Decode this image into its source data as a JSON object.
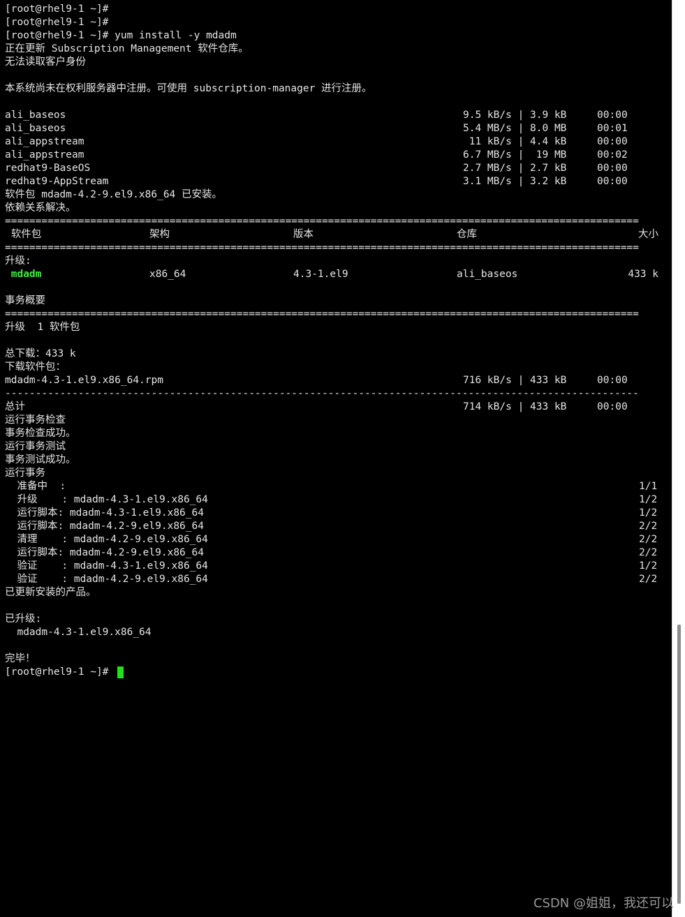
{
  "terminal": {
    "lines": [
      {
        "a": "[root@rhel9-1 ~]#"
      },
      {
        "a": "[root@rhel9-1 ~]#"
      },
      {
        "a": "[root@rhel9-1 ~]# yum install -y mdadm"
      },
      {
        "a": "正在更新 Subscription Management 软件仓库。"
      },
      {
        "a": "无法读取客户身份"
      },
      {
        "a": ""
      },
      {
        "a": "本系统尚未在权利服务器中注册。可使用 subscription-manager 进行注册。"
      },
      {
        "a": ""
      },
      {
        "a": "ali_baseos",
        "b": "9.5 kB/s | 3.9 kB     00:00"
      },
      {
        "a": "ali_baseos",
        "b": "5.4 MB/s | 8.0 MB     00:01"
      },
      {
        "a": "ali_appstream",
        "b": " 11 kB/s | 4.4 kB     00:00"
      },
      {
        "a": "ali_appstream",
        "b": "6.7 MB/s |  19 MB     00:02"
      },
      {
        "a": "redhat9-BaseOS",
        "b": "2.7 MB/s | 2.7 kB     00:00"
      },
      {
        "a": "redhat9-AppStream",
        "b": "3.1 MB/s | 3.2 kB     00:00"
      },
      {
        "a": "软件包 mdadm-4.2-9.el9.x86_64 已安装。"
      },
      {
        "a": "依赖关系解决。"
      },
      {
        "a": "========================================================================================================"
      },
      {
        "a": " 软件包",
        "c1": "架构",
        "c2": "版本",
        "c3": "仓库",
        "c4": "大小"
      },
      {
        "a": "========================================================================================================"
      },
      {
        "a": "升级:"
      },
      {
        "a": " ",
        "g": "mdadm",
        "c1": "x86_64",
        "c2": "4.3-1.el9",
        "c3": "ali_baseos",
        "c4": "433 k"
      },
      {
        "a": ""
      },
      {
        "a": "事务概要"
      },
      {
        "a": "========================================================================================================"
      },
      {
        "a": "升级  1 软件包"
      },
      {
        "a": ""
      },
      {
        "a": "总下载：433 k"
      },
      {
        "a": "下载软件包："
      },
      {
        "a": "mdadm-4.3-1.el9.x86_64.rpm",
        "b": "716 kB/s | 433 kB     00:00"
      },
      {
        "a": "--------------------------------------------------------------------------------------------------------"
      },
      {
        "a": "总计",
        "b": "714 kB/s | 433 kB     00:00"
      },
      {
        "a": "运行事务检查"
      },
      {
        "a": "事务检查成功。"
      },
      {
        "a": "运行事务测试"
      },
      {
        "a": "事务测试成功。"
      },
      {
        "a": "运行事务"
      },
      {
        "a": "  准备中  :",
        "n": "1/1"
      },
      {
        "a": "  升级    : mdadm-4.3-1.el9.x86_64",
        "n": "1/2"
      },
      {
        "a": "  运行脚本: mdadm-4.3-1.el9.x86_64",
        "n": "1/2"
      },
      {
        "a": "  运行脚本: mdadm-4.2-9.el9.x86_64",
        "n": "2/2"
      },
      {
        "a": "  清理    : mdadm-4.2-9.el9.x86_64",
        "n": "2/2"
      },
      {
        "a": "  运行脚本: mdadm-4.2-9.el9.x86_64",
        "n": "2/2"
      },
      {
        "a": "  验证    : mdadm-4.3-1.el9.x86_64",
        "n": "1/2"
      },
      {
        "a": "  验证    : mdadm-4.2-9.el9.x86_64",
        "n": "2/2"
      },
      {
        "a": "已更新安装的产品。"
      },
      {
        "a": ""
      },
      {
        "a": "已升级:"
      },
      {
        "a": "  mdadm-4.3-1.el9.x86_64"
      },
      {
        "a": ""
      },
      {
        "a": "完毕！"
      },
      {
        "a": "[root@rhel9-1 ~]# ",
        "cursor": true
      }
    ]
  },
  "watermark": "CSDN @姐姐，我还可以",
  "colors": {
    "background": "#000000",
    "foreground": "#e6e6e6",
    "highlight": "#3ef03e",
    "cursor": "#22e01e"
  }
}
